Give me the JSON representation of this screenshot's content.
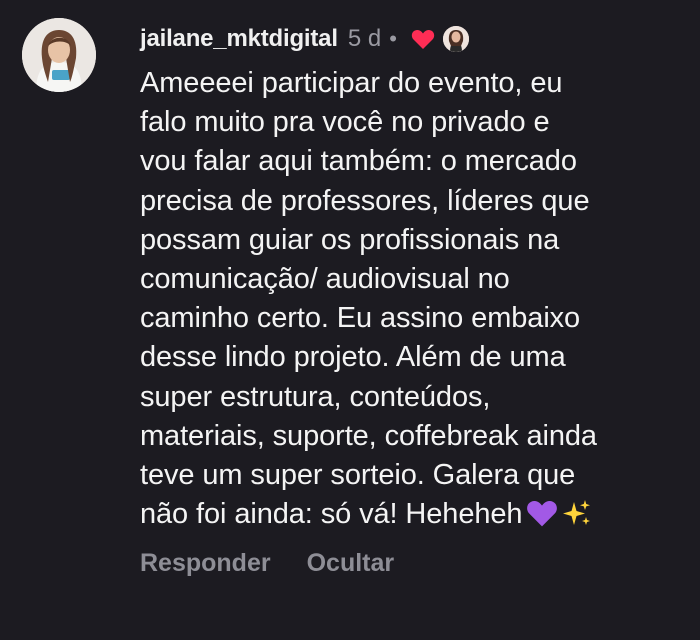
{
  "comment": {
    "username": "jailane_mktdigital",
    "time": "5 d",
    "separator": "•",
    "lines": [
      "Ameeeei participar do evento, eu",
      "falo muito pra você no privado e",
      "vou falar aqui também: o mercado",
      "precisa de professores, líderes que",
      "possam guiar os profissionais na",
      "comunicação/ audiovisual no",
      "caminho certo. Eu assino embaixo",
      "desse lindo projeto. Além de uma",
      "super estrutura, conteúdos,",
      "materiais, suporte, coffebreak ainda",
      "teve um super sorteio. Galera que",
      "não foi ainda: só vá! Heheheh"
    ],
    "trailing_emojis": [
      "purple-heart",
      "sparkles"
    ]
  },
  "actions": {
    "reply_label": "Responder",
    "hide_label": "Ocultar"
  },
  "colors": {
    "background": "#1c1b21",
    "text": "#f4f4f4",
    "muted": "#8e8e96",
    "like_heart": "#ff2d55",
    "purple_heart": "#a259e6",
    "sparkles": "#ffd43b"
  }
}
